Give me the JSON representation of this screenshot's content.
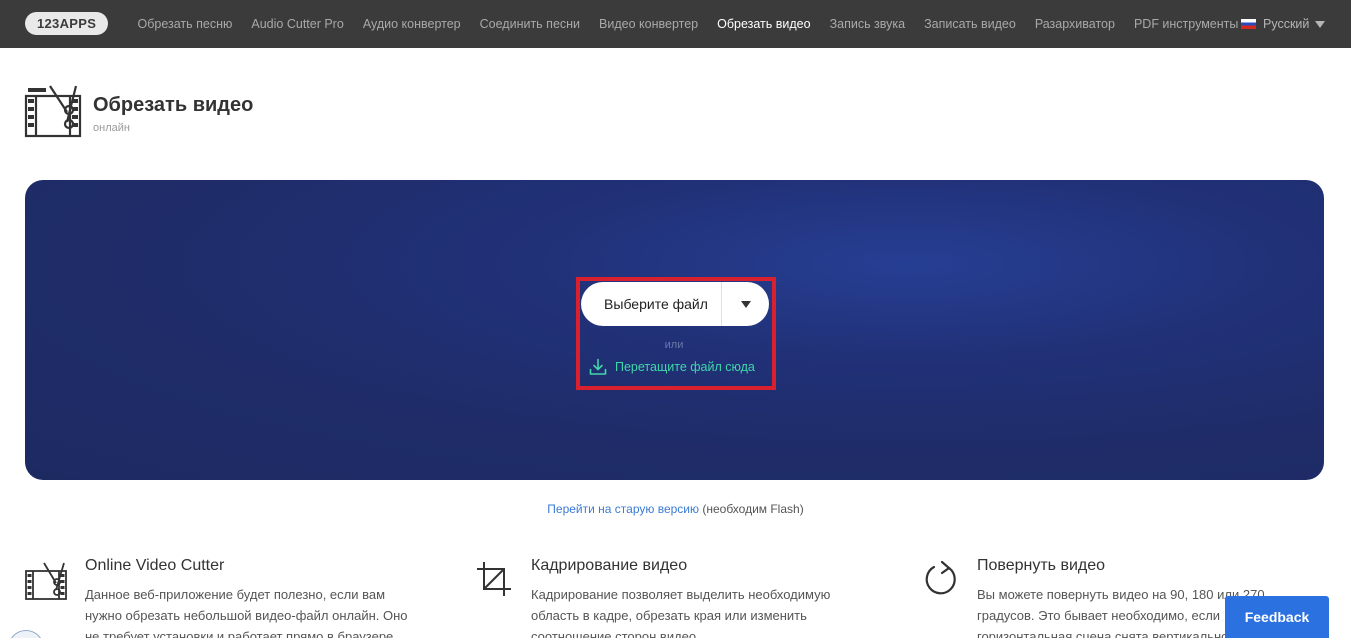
{
  "nav": {
    "logo": "123APPS",
    "items": [
      {
        "label": "Обрезать песню"
      },
      {
        "label": "Audio Cutter Pro"
      },
      {
        "label": "Аудио конвертер"
      },
      {
        "label": "Соединить песни"
      },
      {
        "label": "Видео конвертер"
      },
      {
        "label": "Обрезать видео",
        "active": true
      },
      {
        "label": "Запись звука"
      },
      {
        "label": "Записать видео"
      },
      {
        "label": "Разархиватор"
      },
      {
        "label": "PDF инструменты"
      }
    ],
    "language": "Русский"
  },
  "header": {
    "title": "Обрезать видео",
    "subtitle": "онлайн"
  },
  "upload": {
    "choose_label": "Выберите файл",
    "or": "или",
    "drop_label": "Перетащите файл сюда"
  },
  "old_version": {
    "link": "Перейти на старую версию",
    "note": "(необходим Flash)"
  },
  "features": [
    {
      "title": "Online Video Cutter",
      "lines": [
        "Данное веб-приложение будет полезно, если вам",
        "нужно обрезать небольшой видео-файл онлайн. Оно",
        "не требует установки и работает прямо в браузере."
      ]
    },
    {
      "title": "Кадрирование видео",
      "lines": [
        "Кадрирование позволяет выделить необходимую",
        "область в кадре, обрезать края или изменить",
        "соотношение сторон видео."
      ]
    },
    {
      "title": "Повернуть видео",
      "lines": [
        "Вы можете повернуть видео на 90, 180 или 270",
        "градусов. Это бывает необходимо, если",
        "горизонтальная сцена снята вертикально."
      ]
    }
  ],
  "feedback": "Feedback",
  "colors": {
    "nav_bg": "#3b3b3b",
    "hero_bg": "#1f2c69",
    "drop_text": "#3fd7a9",
    "highlight": "#d9202f",
    "link": "#3a7bd5",
    "feedback_bg": "#2b72e0"
  }
}
